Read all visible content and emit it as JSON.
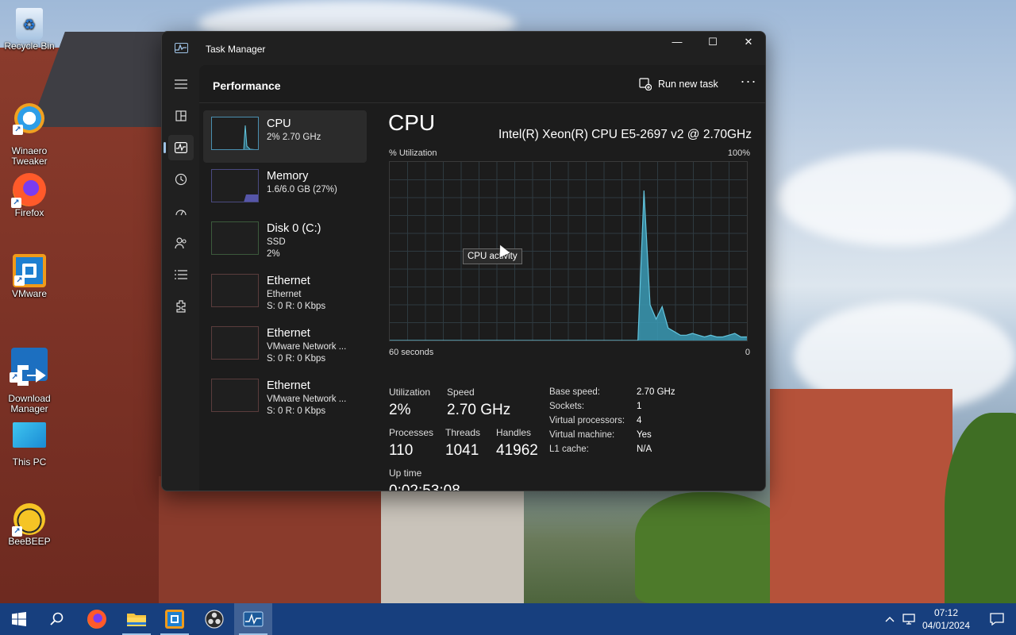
{
  "desktop": {
    "icons": [
      {
        "label": "Recycle Bin",
        "icon": "recycle-bin-icon"
      },
      {
        "label": "Winaero\nTweaker",
        "icon": "winaero-tweaker-icon"
      },
      {
        "label": "Firefox",
        "icon": "firefox-icon"
      },
      {
        "label": "VMware",
        "icon": "vmware-icon"
      },
      {
        "label": "Download\nManager",
        "icon": "download-manager-icon"
      },
      {
        "label": "This PC",
        "icon": "this-pc-icon"
      },
      {
        "label": "BeeBEEP",
        "icon": "beebeep-icon"
      }
    ]
  },
  "window": {
    "title": "Task Manager",
    "minimize_glyph": "—",
    "maximize_glyph": "☐",
    "close_glyph": "✕"
  },
  "header": {
    "title": "Performance",
    "run_new_task": "Run new task",
    "more": "···"
  },
  "resources": [
    {
      "name": "CPU",
      "lines": [
        "2% 2.70 GHz"
      ],
      "active": true
    },
    {
      "name": "Memory",
      "lines": [
        "1.6/6.0 GB (27%)"
      ]
    },
    {
      "name": "Disk 0 (C:)",
      "lines": [
        "SSD",
        "2%"
      ]
    },
    {
      "name": "Ethernet",
      "lines": [
        "Ethernet",
        "S: 0 R: 0 Kbps"
      ]
    },
    {
      "name": "Ethernet",
      "lines": [
        "VMware Network ...",
        "S: 0 R: 0 Kbps"
      ]
    },
    {
      "name": "Ethernet",
      "lines": [
        "VMware Network ...",
        "S: 0 R: 0 Kbps"
      ]
    }
  ],
  "cpu": {
    "title": "CPU",
    "model": "Intel(R) Xeon(R) CPU E5-2697 v2 @ 2.70GHz",
    "util_label": "% Utilization",
    "max_label": "100%",
    "time_left": "60 seconds",
    "time_right": "0",
    "tooltip": "CPU activity",
    "stats": {
      "utilization_label": "Utilization",
      "utilization": "2%",
      "speed_label": "Speed",
      "speed": "2.70 GHz",
      "processes_label": "Processes",
      "processes": "110",
      "threads_label": "Threads",
      "threads": "1041",
      "handles_label": "Handles",
      "handles": "41962",
      "uptime_label": "Up time",
      "uptime": "0:02:53:08"
    },
    "specs": [
      {
        "key": "Base speed:",
        "value": "2.70 GHz"
      },
      {
        "key": "Sockets:",
        "value": "1"
      },
      {
        "key": "Virtual processors:",
        "value": "4"
      },
      {
        "key": "Virtual machine:",
        "value": "Yes"
      },
      {
        "key": "L1 cache:",
        "value": "N/A"
      }
    ],
    "history_percent": [
      0,
      0,
      0,
      0,
      0,
      0,
      0,
      0,
      0,
      0,
      0,
      0,
      0,
      0,
      0,
      0,
      0,
      0,
      0,
      0,
      0,
      0,
      0,
      0,
      0,
      0,
      0,
      0,
      0,
      0,
      0,
      0,
      0,
      0,
      0,
      0,
      0,
      0,
      0,
      0,
      0,
      0,
      84,
      20,
      12,
      19,
      7,
      5,
      3,
      3,
      4,
      3,
      2,
      3,
      2,
      2,
      3,
      4,
      2,
      2
    ]
  },
  "taskbar": {
    "clock_time": "07:12",
    "clock_date": "04/01/2024"
  },
  "colors": {
    "accent": "#9fc3e6",
    "graph_fill": "#3a9ab5",
    "graph_line": "#63c5de",
    "window_bg": "#202020",
    "taskbar_bg": "#173f7e"
  }
}
